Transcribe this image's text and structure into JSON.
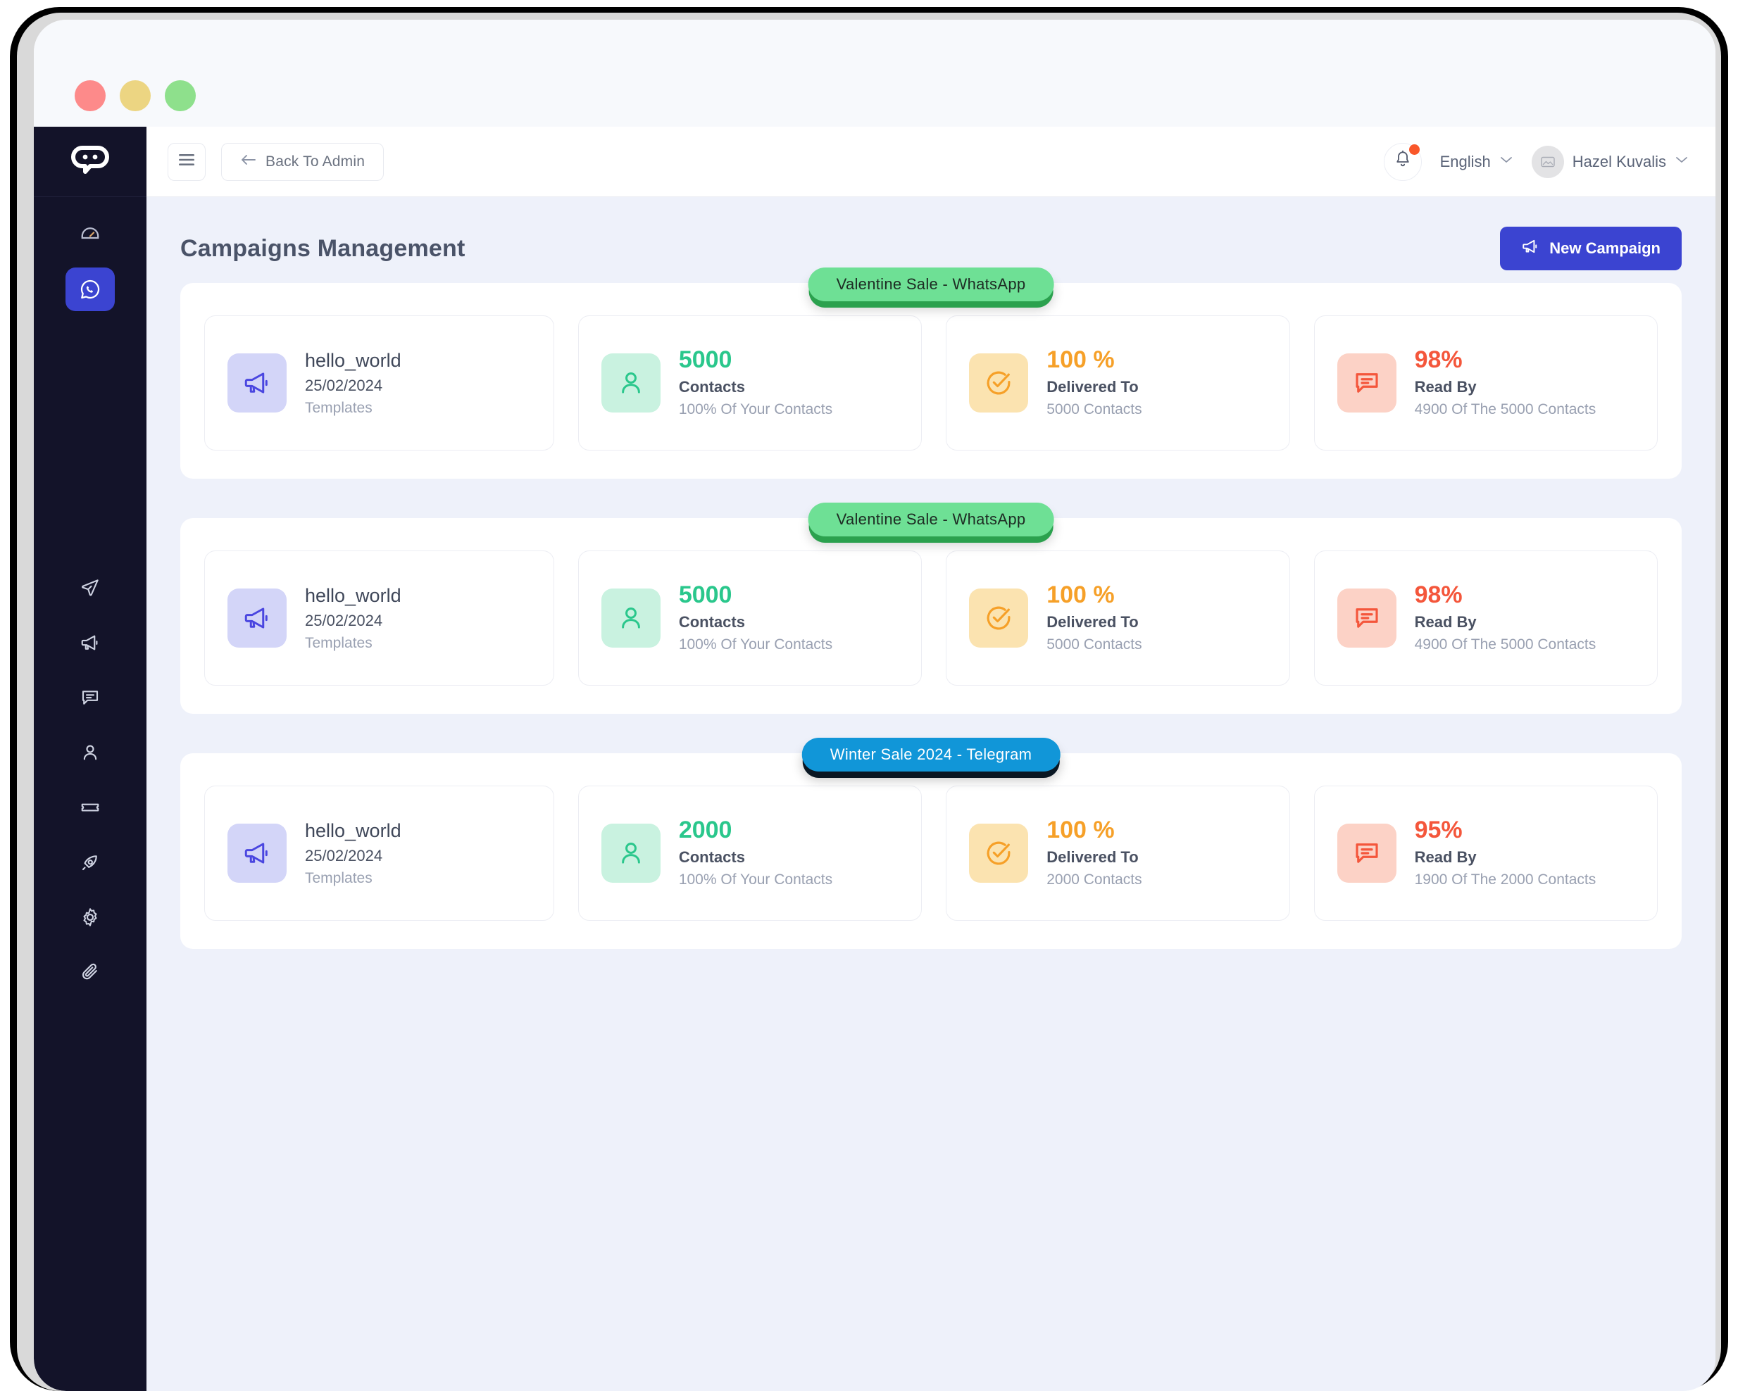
{
  "window": {
    "traffic_lights": [
      {
        "name": "close",
        "color": "#fd8a8a"
      },
      {
        "name": "minimize",
        "color": "#ecd582"
      },
      {
        "name": "maximize",
        "color": "#8ee08c"
      }
    ]
  },
  "sidebar": {
    "logo_icon": "chatbot-logo-icon",
    "items_top": [
      {
        "icon": "dashboard-icon",
        "active": false
      },
      {
        "icon": "whatsapp-icon",
        "active": true
      }
    ],
    "items_bottom": [
      {
        "icon": "send-icon",
        "active": false
      },
      {
        "icon": "megaphone-icon",
        "active": false
      },
      {
        "icon": "chat-icon",
        "active": false
      },
      {
        "icon": "user-icon",
        "active": false
      },
      {
        "icon": "ticket-icon",
        "active": false
      },
      {
        "icon": "pen-nib-icon",
        "active": false
      },
      {
        "icon": "gear-icon",
        "active": false
      },
      {
        "icon": "paperclip-icon",
        "active": false
      }
    ]
  },
  "header": {
    "hamburger_icon": "hamburger-icon",
    "back_label": "Back To Admin",
    "back_arrow_icon": "arrow-left-icon",
    "notification_icon": "bell-icon",
    "notification_dot": true,
    "language": "English",
    "user_name": "Hazel Kuvalis",
    "user_status": "online"
  },
  "page": {
    "title": "Campaigns Management",
    "new_campaign_label": "New Campaign",
    "new_campaign_icon": "megaphone-icon",
    "accent_color": "#3b44d1"
  },
  "campaigns": [
    {
      "badge_label": "Valentine Sale - WhatsApp",
      "badge_type": "whatsapp",
      "template": {
        "icon": "megaphone-icon",
        "name": "hello_world",
        "date": "25/02/2024",
        "category": "Templates"
      },
      "stats": [
        {
          "icon": "user-icon",
          "tone": "mint",
          "value_color": "green",
          "value": "5000",
          "label": "Contacts",
          "sub": "100% Of Your Contacts"
        },
        {
          "icon": "check-circle-icon",
          "tone": "amber",
          "value_color": "orange",
          "value": "100 %",
          "label": "Delivered To",
          "sub": "5000 Contacts"
        },
        {
          "icon": "chat-icon",
          "tone": "coral",
          "value_color": "red",
          "value": "98%",
          "label": "Read By",
          "sub": "4900 Of The 5000 Contacts"
        }
      ]
    },
    {
      "badge_label": "Valentine Sale - WhatsApp",
      "badge_type": "whatsapp",
      "template": {
        "icon": "megaphone-icon",
        "name": "hello_world",
        "date": "25/02/2024",
        "category": "Templates"
      },
      "stats": [
        {
          "icon": "user-icon",
          "tone": "mint",
          "value_color": "green",
          "value": "5000",
          "label": "Contacts",
          "sub": "100% Of Your Contacts"
        },
        {
          "icon": "check-circle-icon",
          "tone": "amber",
          "value_color": "orange",
          "value": "100 %",
          "label": "Delivered To",
          "sub": "5000 Contacts"
        },
        {
          "icon": "chat-icon",
          "tone": "coral",
          "value_color": "red",
          "value": "98%",
          "label": "Read By",
          "sub": "4900 Of The 5000 Contacts"
        }
      ]
    },
    {
      "badge_label": "Winter Sale 2024 - Telegram",
      "badge_type": "telegram",
      "template": {
        "icon": "megaphone-icon",
        "name": "hello_world",
        "date": "25/02/2024",
        "category": "Templates"
      },
      "stats": [
        {
          "icon": "user-icon",
          "tone": "mint",
          "value_color": "green",
          "value": "2000",
          "label": "Contacts",
          "sub": "100% Of Your Contacts"
        },
        {
          "icon": "check-circle-icon",
          "tone": "amber",
          "value_color": "orange",
          "value": "100 %",
          "label": "Delivered To",
          "sub": "2000 Contacts"
        },
        {
          "icon": "chat-icon",
          "tone": "coral",
          "value_color": "red",
          "value": "95%",
          "label": "Read By",
          "sub": "1900 Of The 2000 Contacts"
        }
      ]
    }
  ]
}
